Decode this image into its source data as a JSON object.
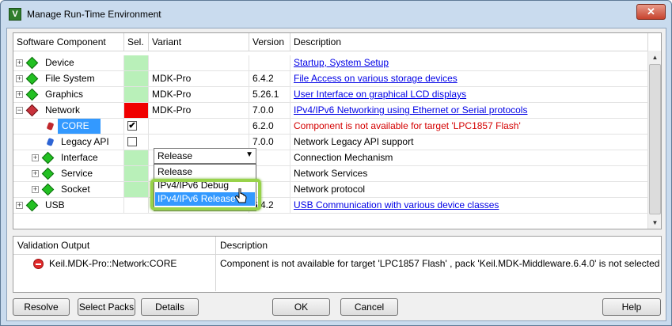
{
  "window": {
    "title": "Manage Run-Time Environment",
    "app_icon_letter": "V",
    "close_symbol": "✕"
  },
  "columns": [
    "Software Component",
    "Sel.",
    "Variant",
    "Version",
    "Description"
  ],
  "components": [
    {
      "name": "Device",
      "sel": "",
      "variant": "",
      "version": "",
      "description": "Startup, System Setup",
      "desc_style": "link"
    },
    {
      "name": "File System",
      "sel": "",
      "variant": "MDK-Pro",
      "version": "6.4.2",
      "description": "File Access on various storage devices",
      "desc_style": "link"
    },
    {
      "name": "Graphics",
      "sel": "",
      "variant": "MDK-Pro",
      "version": "5.26.1",
      "description": "User Interface on graphical LCD displays",
      "desc_style": "link"
    },
    {
      "name": "Network",
      "sel": "",
      "variant": "MDK-Pro",
      "version": "7.0.0",
      "description": "IPv4/IPv6 Networking using Ethernet or Serial protocols",
      "desc_style": "link"
    },
    {
      "name": "CORE",
      "sel": "✔",
      "variant": "Release",
      "version": "6.2.0",
      "description": "Component is not available for target 'LPC1857 Flash'",
      "desc_style": "error"
    },
    {
      "name": "Legacy API",
      "sel": "",
      "variant": "",
      "version": "7.0.0",
      "description": "Network Legacy API support",
      "desc_style": "plain"
    },
    {
      "name": "Interface",
      "sel": "",
      "variant": "",
      "version": "",
      "description": "Connection Mechanism",
      "desc_style": "plain"
    },
    {
      "name": "Service",
      "sel": "",
      "variant": "",
      "version": "",
      "description": "Network Services",
      "desc_style": "plain"
    },
    {
      "name": "Socket",
      "sel": "",
      "variant": "",
      "version": "",
      "description": "Network protocol",
      "desc_style": "plain"
    },
    {
      "name": "USB",
      "sel": "",
      "variant": "MDK-Pro",
      "version": "6.4.2",
      "description": "USB Communication with various device classes",
      "desc_style": "link"
    }
  ],
  "variant_dropdown": {
    "selected": "Release",
    "options": [
      "Release",
      "IPv4/IPv6 Debug",
      "IPv4/IPv6 Release"
    ],
    "highlighted": "IPv4/IPv6 Release"
  },
  "validation": {
    "headers": [
      "Validation Output",
      "Description"
    ],
    "output": "Keil.MDK-Pro::Network:CORE",
    "description": "Component is not available for target 'LPC1857 Flash' , pack 'Keil.MDK-Middleware.6.4.0' is not selected"
  },
  "buttons": {
    "resolve": "Resolve",
    "select_packs": "Select Packs",
    "details": "Details",
    "ok": "OK",
    "cancel": "Cancel",
    "help": "Help"
  },
  "colors": {
    "selected_green": "#b9f0b9",
    "selected_red": "#f00000",
    "error_text": "#d40000",
    "link": "#0000e6",
    "highlight": "#3399ff"
  }
}
